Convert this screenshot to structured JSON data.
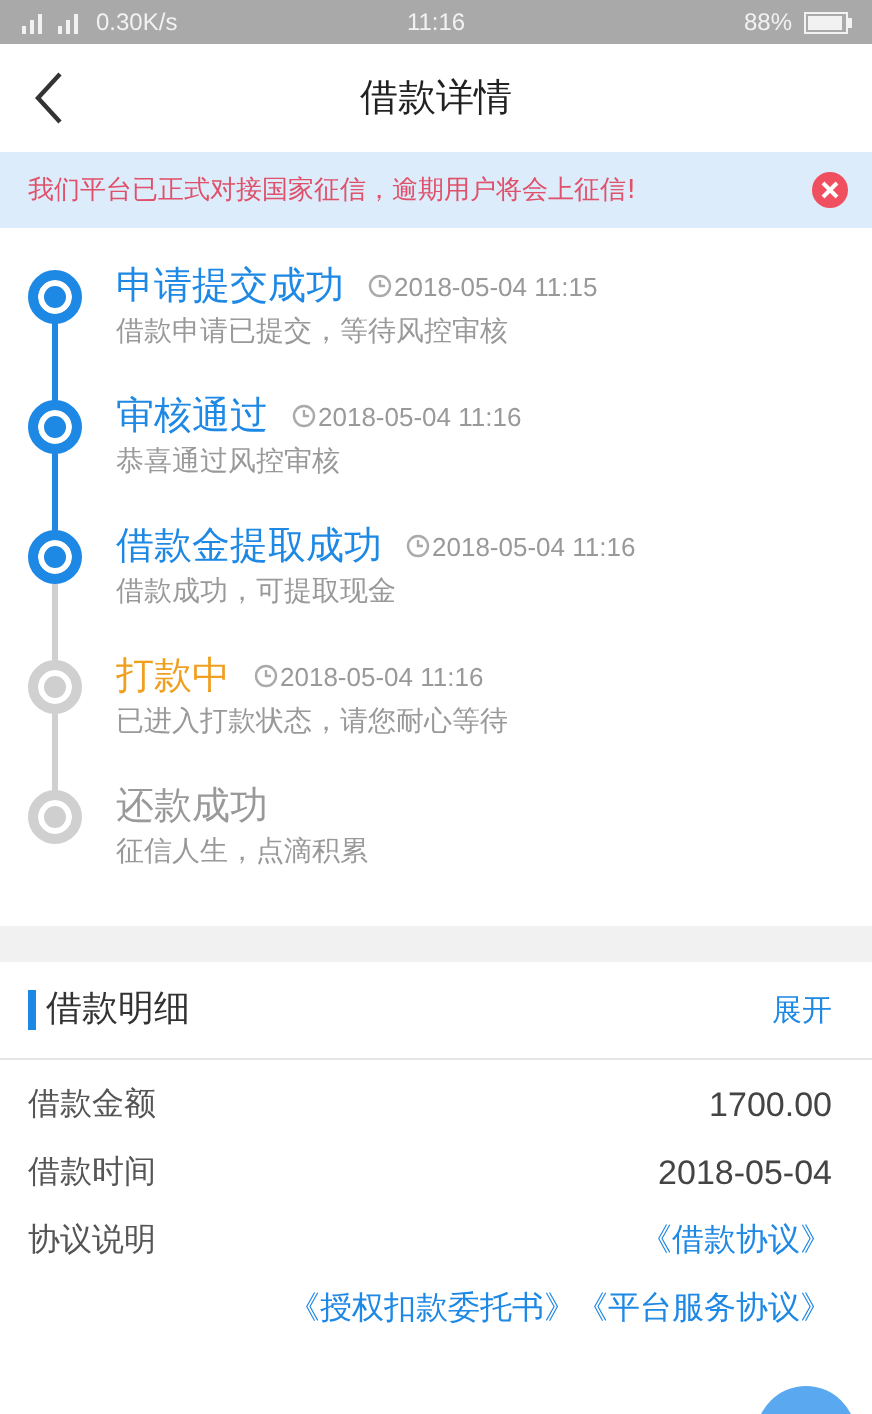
{
  "status_bar": {
    "speed": "0.30K/s",
    "time": "11:16",
    "battery": "88%"
  },
  "header": {
    "title": "借款详情"
  },
  "notice": {
    "text": "我们平台已正式对接国家征信，逾期用户将会上征信!"
  },
  "steps": [
    {
      "title": "申请提交成功",
      "time": "2018-05-04 11:15",
      "desc": "借款申请已提交，等待风控审核",
      "kind": "done"
    },
    {
      "title": "审核通过",
      "time": "2018-05-04 11:16",
      "desc": "恭喜通过风控审核",
      "kind": "done"
    },
    {
      "title": "借款金提取成功",
      "time": "2018-05-04 11:16",
      "desc": "借款成功，可提取现金",
      "kind": "done"
    },
    {
      "title": "打款中",
      "time": "2018-05-04 11:16",
      "desc": "已进入打款状态，请您耐心等待",
      "kind": "current"
    },
    {
      "title": "还款成功",
      "desc": "征信人生，点滴积累",
      "kind": "pending"
    }
  ],
  "details": {
    "title": "借款明细",
    "toggle": "展开",
    "rows": [
      {
        "label": "借款金额",
        "value": "1700.00"
      },
      {
        "label": "借款时间",
        "value": "2018-05-04"
      }
    ],
    "agreements": {
      "label": "协议说明",
      "links": [
        "《借款协议》",
        "《授权扣款委托书》",
        "《平台服务协议》"
      ]
    }
  }
}
